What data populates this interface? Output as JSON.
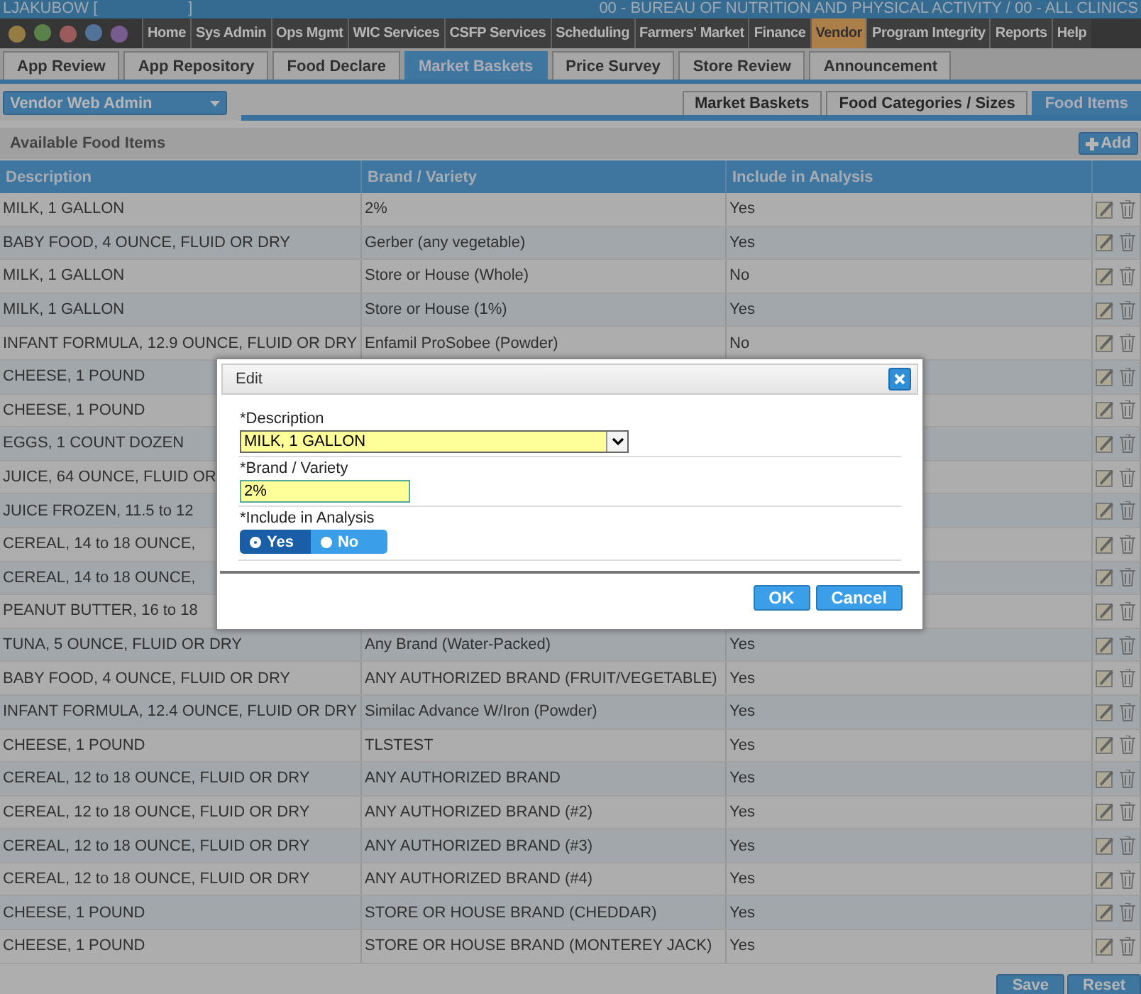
{
  "top_bar": {
    "user": "LJAKUBOW [",
    "user_close": "]",
    "agency": "00 - BUREAU OF NUTRITION AND PHYSICAL ACTIVITY / 00 - ALL CLINICS"
  },
  "menu": [
    {
      "label": "Home",
      "selected": false
    },
    {
      "label": "Sys Admin",
      "selected": false
    },
    {
      "label": "Ops Mgmt",
      "selected": false
    },
    {
      "label": "WIC Services",
      "selected": false
    },
    {
      "label": "CSFP Services",
      "selected": false
    },
    {
      "label": "Scheduling",
      "selected": false
    },
    {
      "label": "Farmers' Market",
      "selected": false
    },
    {
      "label": "Finance",
      "selected": false
    },
    {
      "label": "Vendor",
      "selected": true
    },
    {
      "label": "Program Integrity",
      "selected": false
    },
    {
      "label": "Reports",
      "selected": false
    },
    {
      "label": "Help",
      "selected": false
    }
  ],
  "tabs": [
    {
      "label": "App Review",
      "selected": false
    },
    {
      "label": "App Repository",
      "selected": false
    },
    {
      "label": "Food Declare",
      "selected": false
    },
    {
      "label": "Market Baskets",
      "selected": true
    },
    {
      "label": "Price Survey",
      "selected": false
    },
    {
      "label": "Store Review",
      "selected": false
    },
    {
      "label": "Announcement",
      "selected": false
    }
  ],
  "module_select": {
    "value": "Vendor Web Admin"
  },
  "sub_tabs": [
    {
      "label": "Market Baskets",
      "selected": false
    },
    {
      "label": "Food Categories / Sizes",
      "selected": false
    },
    {
      "label": "Food Items",
      "selected": true
    }
  ],
  "panel": {
    "title": "Available Food Items",
    "add_button": "Add"
  },
  "table": {
    "columns": [
      "Description",
      "Brand / Variety",
      "Include in Analysis"
    ],
    "rows": [
      {
        "description": "MILK, 1 GALLON",
        "brand": "2%",
        "include": "Yes"
      },
      {
        "description": "BABY FOOD, 4 OUNCE, FLUID OR DRY",
        "brand": "Gerber (any vegetable)",
        "include": "Yes"
      },
      {
        "description": "MILK, 1 GALLON",
        "brand": "Store or House (Whole)",
        "include": "No"
      },
      {
        "description": "MILK, 1 GALLON",
        "brand": "Store or House (1%)",
        "include": "Yes"
      },
      {
        "description": "INFANT FORMULA, 12.9 OUNCE, FLUID OR DRY",
        "brand": "Enfamil ProSobee (Powder)",
        "include": "No"
      },
      {
        "description": "CHEESE, 1 POUND"
      },
      {
        "description": "CHEESE, 1 POUND"
      },
      {
        "description": "EGGS, 1 COUNT DOZEN"
      },
      {
        "description": "JUICE, 64 OUNCE, FLUID OR"
      },
      {
        "description": "JUICE FROZEN, 11.5 to 12"
      },
      {
        "description": "CEREAL, 14 to 18 OUNCE,"
      },
      {
        "description": "CEREAL, 14 to 18 OUNCE,"
      },
      {
        "description": "PEANUT BUTTER, 16 to 18"
      },
      {
        "description": "TUNA, 5 OUNCE, FLUID OR DRY",
        "brand": "Any Brand (Water-Packed)",
        "include": "Yes"
      },
      {
        "description": "BABY FOOD, 4 OUNCE, FLUID OR DRY",
        "brand": "ANY AUTHORIZED BRAND (FRUIT/VEGETABLE)",
        "include": "Yes"
      },
      {
        "description": "INFANT FORMULA, 12.4 OUNCE, FLUID OR DRY",
        "brand": "Similac Advance W/Iron (Powder)",
        "include": "Yes"
      },
      {
        "description": "CHEESE, 1 POUND",
        "brand": "TLSTEST",
        "include": "Yes"
      },
      {
        "description": "CEREAL, 12 to 18 OUNCE, FLUID OR DRY",
        "brand": "ANY AUTHORIZED BRAND",
        "include": "Yes"
      },
      {
        "description": "CEREAL, 12 to 18 OUNCE, FLUID OR DRY",
        "brand": "ANY AUTHORIZED BRAND (#2)",
        "include": "Yes"
      },
      {
        "description": "CEREAL, 12 to 18 OUNCE, FLUID OR DRY",
        "brand": "ANY AUTHORIZED BRAND (#3)",
        "include": "Yes"
      },
      {
        "description": "CEREAL, 12 to 18 OUNCE, FLUID OR DRY",
        "brand": "ANY AUTHORIZED BRAND (#4)",
        "include": "Yes"
      },
      {
        "description": "CHEESE, 1 POUND",
        "brand": "STORE OR HOUSE BRAND (CHEDDAR)",
        "include": "Yes"
      },
      {
        "description": "CHEESE, 1 POUND",
        "brand": "STORE OR HOUSE BRAND (MONTEREY JACK)",
        "include": "Yes"
      }
    ]
  },
  "footer_buttons": [
    "Save",
    "Reset"
  ],
  "dialog": {
    "title": "Edit",
    "fields": [
      {
        "kind": "select",
        "label": "*Description",
        "value": "MILK, 1 GALLON"
      },
      {
        "kind": "text",
        "label": "*Brand / Variety",
        "value": "2%"
      },
      {
        "kind": "radio",
        "label": "*Include in Analysis",
        "options": [
          {
            "label": "Yes",
            "selected": true
          },
          {
            "label": "No",
            "selected": false
          }
        ]
      }
    ],
    "buttons": [
      "OK",
      "Cancel"
    ]
  }
}
